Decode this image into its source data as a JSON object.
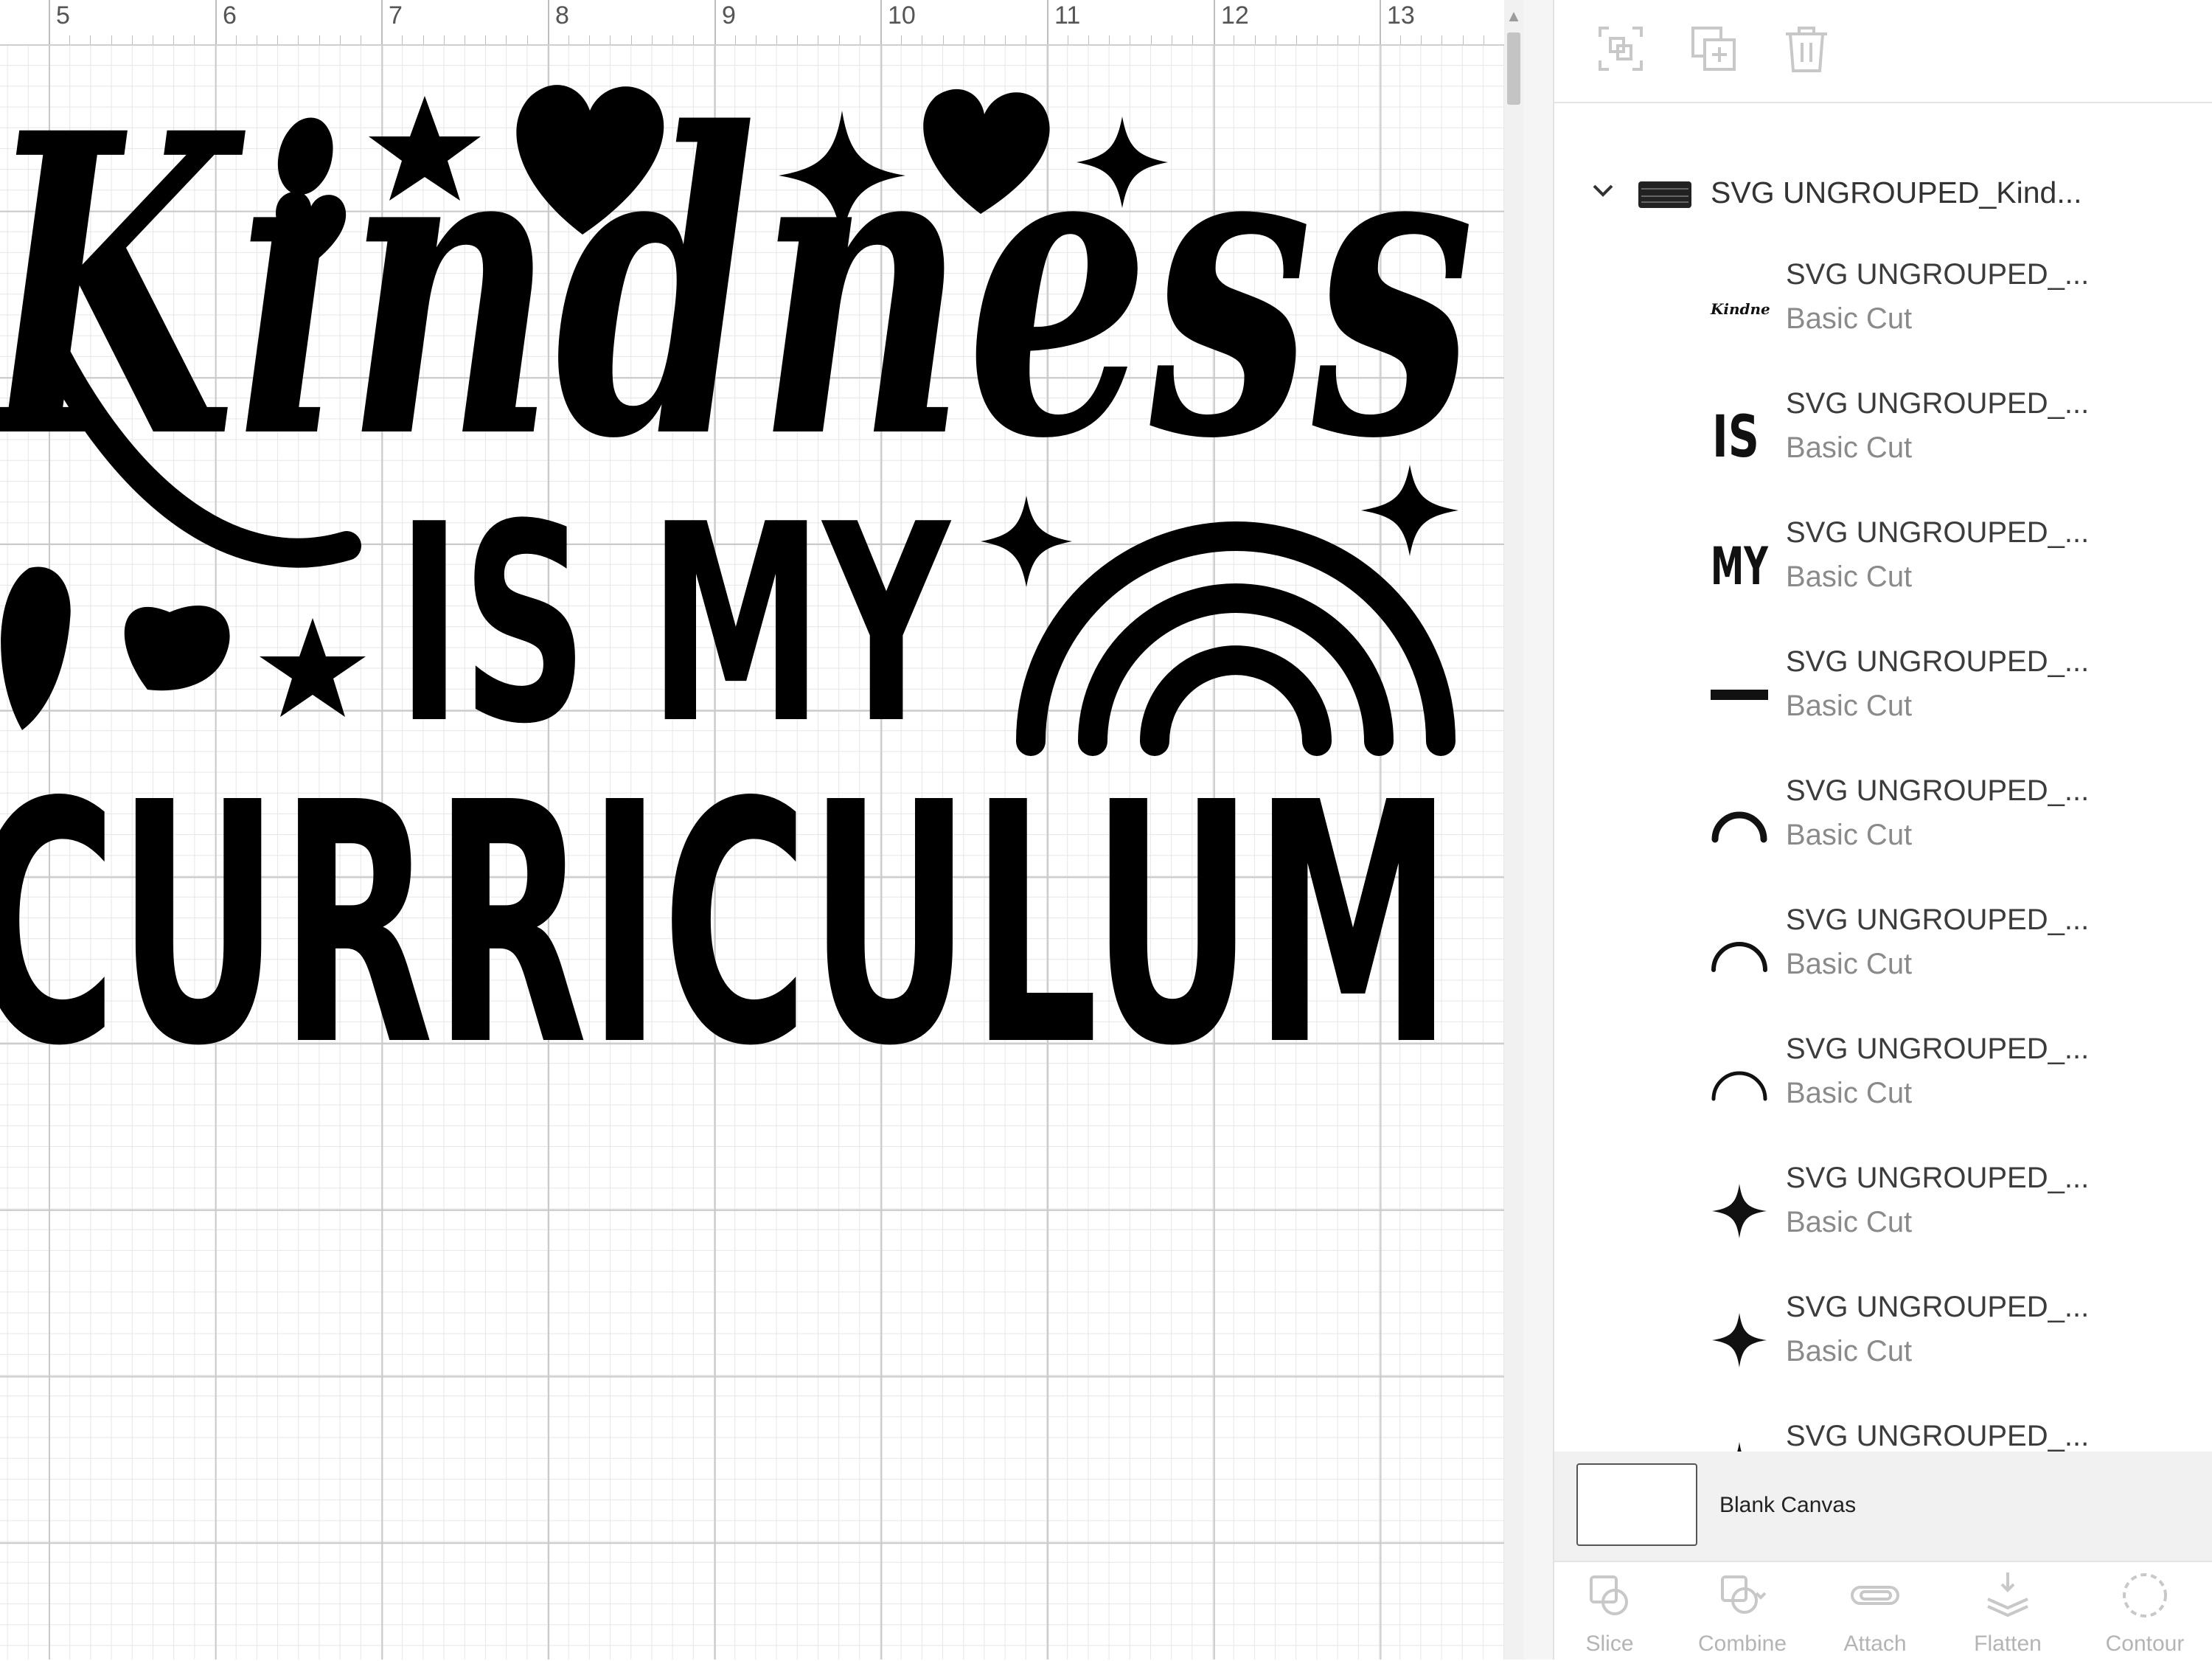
{
  "ruler": {
    "numbers": [
      "5",
      "6",
      "7",
      "8",
      "9",
      "10",
      "11",
      "12",
      "13"
    ]
  },
  "canvas": {
    "artwork_text": {
      "line1": "Kindness",
      "line2": "IS MY",
      "line3": "CURRICULUM"
    }
  },
  "panel_toolbar": {
    "icons": [
      "group-icon",
      "duplicate-icon",
      "delete-icon"
    ]
  },
  "layers": {
    "group": {
      "name": "SVG UNGROUPED_Kind...",
      "thumb_icon": "design-thumbnail"
    },
    "items": [
      {
        "name": "SVG UNGROUPED_...",
        "operation": "Basic Cut",
        "thumb_icon": "kindness-script-thumb"
      },
      {
        "name": "SVG UNGROUPED_...",
        "operation": "Basic Cut",
        "thumb_icon": "is-text-thumb",
        "thumb_text": "IS"
      },
      {
        "name": "SVG UNGROUPED_...",
        "operation": "Basic Cut",
        "thumb_icon": "my-text-thumb",
        "thumb_text": "MY"
      },
      {
        "name": "SVG UNGROUPED_...",
        "operation": "Basic Cut",
        "thumb_icon": "curriculum-text-thumb"
      },
      {
        "name": "SVG UNGROUPED_...",
        "operation": "Basic Cut",
        "thumb_icon": "arc-thumb"
      },
      {
        "name": "SVG UNGROUPED_...",
        "operation": "Basic Cut",
        "thumb_icon": "arc-thumb"
      },
      {
        "name": "SVG UNGROUPED_...",
        "operation": "Basic Cut",
        "thumb_icon": "arc-thumb"
      },
      {
        "name": "SVG UNGROUPED_...",
        "operation": "Basic Cut",
        "thumb_icon": "sparkle-thumb"
      },
      {
        "name": "SVG UNGROUPED_...",
        "operation": "Basic Cut",
        "thumb_icon": "sparkle-thumb"
      },
      {
        "name": "SVG UNGROUPED_...",
        "operation": "",
        "thumb_icon": "sparkle-thumb"
      }
    ]
  },
  "blank_canvas": {
    "label": "Blank Canvas"
  },
  "bottom_toolbar": {
    "items": [
      {
        "label": "Slice",
        "icon": "slice-icon"
      },
      {
        "label": "Combine",
        "icon": "combine-icon"
      },
      {
        "label": "Attach",
        "icon": "attach-icon"
      },
      {
        "label": "Flatten",
        "icon": "flatten-icon"
      },
      {
        "label": "Contour",
        "icon": "contour-icon"
      }
    ]
  },
  "colors": {
    "artwork": "#000000",
    "disabled_icon": "#c8c8c8",
    "disabled_label": "#b4b4b4",
    "panel_footer": "#f1f1f1"
  }
}
